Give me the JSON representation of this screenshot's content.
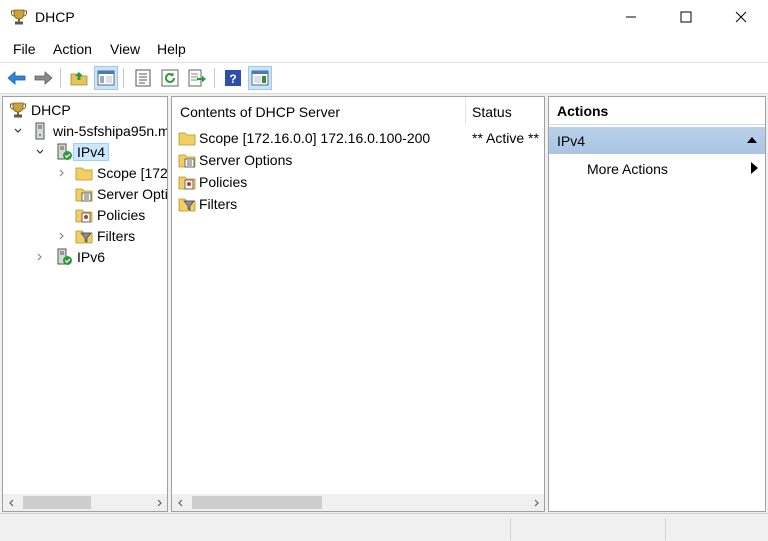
{
  "window": {
    "title": "DHCP"
  },
  "menu": [
    "File",
    "Action",
    "View",
    "Help"
  ],
  "tree": {
    "root": "DHCP",
    "server": "win-5sfshipa95n.m",
    "ipv4": "IPv4",
    "scope": "Scope [172.",
    "server_options": "Server Opti",
    "policies": "Policies",
    "filters": "Filters",
    "ipv6": "IPv6"
  },
  "content": {
    "columns": {
      "name": "Contents of DHCP Server",
      "status": "Status"
    },
    "rows": [
      {
        "name": "Scope [172.16.0.0] 172.16.0.100-200",
        "status": "** Active **"
      },
      {
        "name": "Server Options",
        "status": ""
      },
      {
        "name": "Policies",
        "status": ""
      },
      {
        "name": "Filters",
        "status": ""
      }
    ]
  },
  "actions": {
    "header": "Actions",
    "group": "IPv4",
    "more": "More Actions"
  },
  "colors": {
    "selection": "#cce8ff",
    "actions_group": "#b9d1ea"
  }
}
